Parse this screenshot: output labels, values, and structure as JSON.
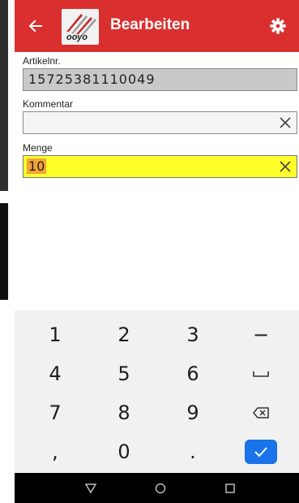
{
  "appbar": {
    "title": "Bearbeiten",
    "icons": [
      "back-arrow-icon",
      "company-logo",
      "settings-gear-icon"
    ],
    "logo_text": "ооуо"
  },
  "fields": {
    "article": {
      "label": "Artikelnr.",
      "value": "15725381110049"
    },
    "comment": {
      "label": "Kommentar",
      "value": ""
    },
    "quantity": {
      "label": "Menge",
      "value": "10"
    }
  },
  "keyboard": {
    "row1": [
      "1",
      "2",
      "3",
      "−"
    ],
    "row2": [
      "4",
      "5",
      "6"
    ],
    "row3": [
      "7",
      "8",
      "9"
    ],
    "row4": [
      ",",
      "0",
      "."
    ]
  },
  "colors": {
    "appbar": "#d9302f",
    "quantity_bg": "#ffff2a",
    "selection": "#f2a33a",
    "enter_key": "#1a73e8"
  }
}
